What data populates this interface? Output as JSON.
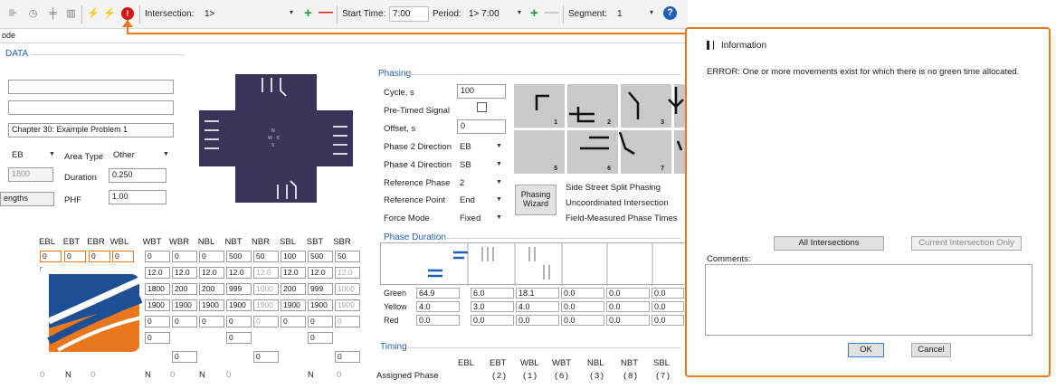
{
  "toolbar": {
    "icons": [
      "traffic-signal-icon",
      "clock-icon",
      "intersection-icon",
      "chart-icon",
      "lightning-icon",
      "lightning-warning-icon",
      "error-icon",
      "help-icon"
    ],
    "intersection_label": "Intersection:",
    "intersection_value": "1>",
    "start_time_label": "Start Time:",
    "start_time_value": "7:00",
    "period_label": "Period:",
    "period_value": "1> 7:00",
    "segment_label": "Segment:",
    "segment_value": "1",
    "plus": "+",
    "minus": "—",
    "dropdown": "▾",
    "error_glyph": "!",
    "help_glyph": "?"
  },
  "left": {
    "tab_label": "ode",
    "section_label": "DATA",
    "field1": "",
    "field2": "",
    "problem_title": "Chapter 30: Example Problem 1",
    "direction_value": "EB",
    "area_type_label": "Area Type",
    "area_type_value": "Other",
    "grey_value": "1800",
    "duration_label": "Duration",
    "duration_value": "0.250",
    "lengths_label": "engths",
    "phf_label": "PHF",
    "phf_value": "1.00"
  },
  "movement_headers": [
    "EBL",
    "EBT",
    "EBR",
    "WBL",
    "WBT",
    "WBR",
    "NBL",
    "NBT",
    "NBR",
    "SBL",
    "SBT",
    "SBR"
  ],
  "movement_rows": [
    [
      "0",
      "0",
      "0",
      "0",
      "0",
      "0",
      "0",
      "500",
      "50",
      "100",
      "500",
      "50"
    ],
    [
      "12",
      "",
      "",
      "",
      "12.0",
      "12.0",
      "12.0",
      "12.0",
      "12.0",
      "12.0",
      "12.0",
      "12.0"
    ],
    [
      "20",
      "",
      "",
      "",
      "1800",
      "200",
      "200",
      "999",
      "1000",
      "200",
      "999",
      "1000"
    ],
    [
      "19",
      "",
      "",
      "",
      "1900",
      "1900",
      "1900",
      "1900",
      "1900",
      "1900",
      "1900",
      "1900"
    ],
    [
      "0",
      "",
      "",
      "",
      "0",
      "0",
      "0",
      "0",
      "0",
      "0",
      "0",
      "0"
    ]
  ],
  "extra_rows": {
    "row6": [
      "0",
      "0",
      "0"
    ],
    "row7": [
      "0",
      "0",
      "0"
    ],
    "row8": [
      "0",
      "N",
      "0",
      "N",
      "0",
      "N",
      "0",
      "N",
      "0"
    ]
  },
  "phasing": {
    "title": "Phasing",
    "cycle_label": "Cycle, s",
    "cycle_value": "100",
    "pretimed_label": "Pre-Timed Signal",
    "offset_label": "Offset, s",
    "offset_value": "0",
    "phase2_label": "Phase 2 Direction",
    "phase2_value": "EB",
    "phase4_label": "Phase 4 Direction",
    "phase4_value": "SB",
    "refphase_label": "Reference Phase",
    "refphase_value": "2",
    "refpoint_label": "Reference Point",
    "refpoint_value": "End",
    "forcemode_label": "Force Mode",
    "forcemode_value": "Fixed",
    "wizard_label": "Phasing Wizard",
    "note1": "Side Street Split Phasing",
    "note2": "Uncoordinated Intersection",
    "note3": "Field-Measured Phase Times",
    "phase_numbers": [
      "1",
      "2",
      "3",
      "4",
      "5",
      "6",
      "7",
      "8"
    ]
  },
  "phase_duration": {
    "title": "Phase Duration",
    "rows": [
      {
        "label": "Green",
        "values": [
          "64.9",
          "6.0",
          "18.1",
          "0.0",
          "0.0",
          "0.0"
        ]
      },
      {
        "label": "Yellow",
        "values": [
          "4.0",
          "3.0",
          "4.0",
          "0.0",
          "0.0",
          "0.0"
        ]
      },
      {
        "label": "Red",
        "values": [
          "0.0",
          "0.0",
          "0.0",
          "0.0",
          "0.0",
          "0.0"
        ]
      }
    ]
  },
  "timing": {
    "title": "Timing",
    "headers": [
      "EBL",
      "EBT",
      "WBL",
      "WBT",
      "NBL",
      "NBT",
      "SBL"
    ],
    "assigned_label": "Assigned Phase",
    "assigned_values": [
      "",
      "(2)",
      "(1)",
      "(6)",
      "(3)",
      "(8)",
      "(7)"
    ]
  },
  "dialog": {
    "title": "Information",
    "message": "ERROR: One or more movements exist for which there is no green time allocated.",
    "all_intersections": "All Intersections",
    "current_only": "Current Intersection Only",
    "comments_label": "Comments:",
    "ok": "OK",
    "cancel": "Cancel"
  },
  "colors": {
    "accent": "#e8771e",
    "error": "#d41616",
    "link": "#1f5fb8",
    "map": "#3b3459"
  }
}
